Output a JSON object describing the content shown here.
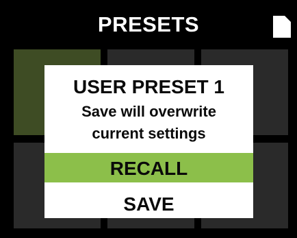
{
  "header": {
    "title": "PRESETS",
    "icon": "file-icon"
  },
  "colors": {
    "background": "#000000",
    "cell": "#2a2a2a",
    "cell_selected": "#3e4c24",
    "dialog": "#ffffff",
    "highlight": "#8cbf4a",
    "text_dark": "#0a0a0a",
    "text_light": "#ffffff"
  },
  "preset_grid": {
    "selected_index": 0,
    "cell_count": 6
  },
  "dialog": {
    "title": "USER PRESET 1",
    "message_line_1": "Save will overwrite",
    "message_line_2": "current settings",
    "options": [
      {
        "label": "RECALL",
        "highlighted": true
      },
      {
        "label": "SAVE",
        "highlighted": false
      }
    ]
  }
}
